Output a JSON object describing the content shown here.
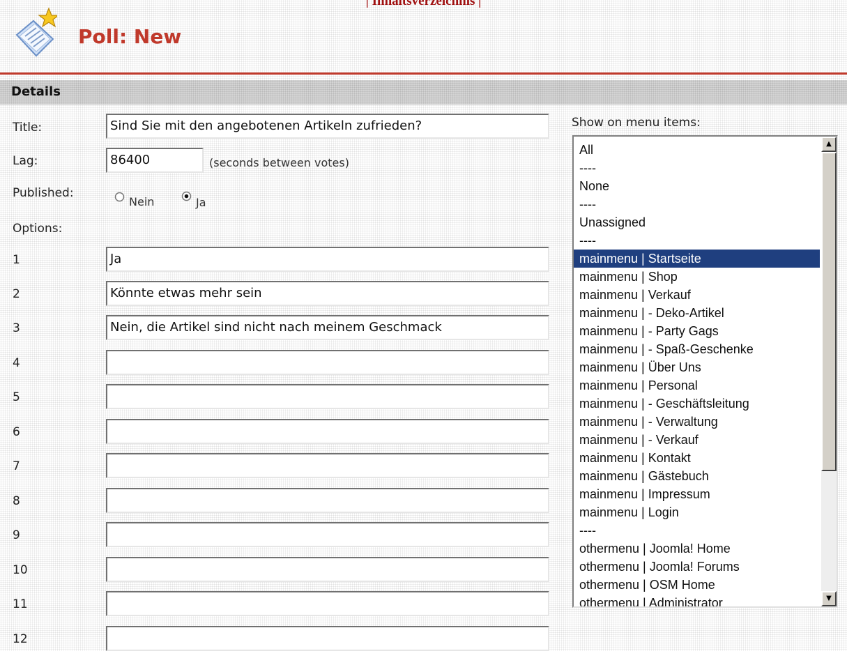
{
  "toc_link": "| Inhaltsverzeichnis |",
  "header": {
    "title_prefix": "Poll:",
    "title_suffix": "New"
  },
  "details_heading": "Details",
  "form": {
    "title_label": "Title:",
    "title_value": "Sind Sie mit den angebotenen Artikeln zufrieden?",
    "lag_label": "Lag:",
    "lag_value": "86400",
    "lag_hint": "(seconds between votes)",
    "published_label": "Published:",
    "published_no": "Nein",
    "published_yes": "Ja",
    "published_selected": "Ja",
    "options_label": "Options:"
  },
  "options": [
    {
      "num": "1",
      "value": "Ja"
    },
    {
      "num": "2",
      "value": "Könnte etwas mehr sein"
    },
    {
      "num": "3",
      "value": "Nein, die Artikel sind nicht nach meinem Geschmack"
    },
    {
      "num": "4",
      "value": ""
    },
    {
      "num": "5",
      "value": ""
    },
    {
      "num": "6",
      "value": ""
    },
    {
      "num": "7",
      "value": ""
    },
    {
      "num": "8",
      "value": ""
    },
    {
      "num": "9",
      "value": ""
    },
    {
      "num": "10",
      "value": ""
    },
    {
      "num": "11",
      "value": ""
    },
    {
      "num": "12",
      "value": ""
    }
  ],
  "menu": {
    "label": "Show on menu items:",
    "items": [
      "All",
      "----",
      "None",
      "----",
      "Unassigned",
      "----",
      "mainmenu | Startseite",
      "mainmenu | Shop",
      "mainmenu | Verkauf",
      "mainmenu |    - Deko-Artikel",
      "mainmenu |    - Party Gags",
      "mainmenu |    - Spaß-Geschenke",
      "mainmenu | Über Uns",
      "mainmenu | Personal",
      "mainmenu |    - Geschäftsleitung",
      "mainmenu |    - Verwaltung",
      "mainmenu |    - Verkauf",
      "mainmenu | Kontakt",
      "mainmenu | Gästebuch",
      "mainmenu | Impressum",
      "mainmenu | Login",
      "----",
      "othermenu | Joomla! Home",
      "othermenu | Joomla! Forums",
      "othermenu | OSM Home",
      "othermenu | Administrator"
    ],
    "selected": "mainmenu | Startseite"
  },
  "icons": {
    "poll": "poll-document-star-icon",
    "scroll_up": "scroll-up-arrow-icon",
    "scroll_down": "scroll-down-arrow-icon"
  },
  "colors": {
    "accent_red": "#c0392b",
    "selection_blue": "#1f3f7f"
  }
}
